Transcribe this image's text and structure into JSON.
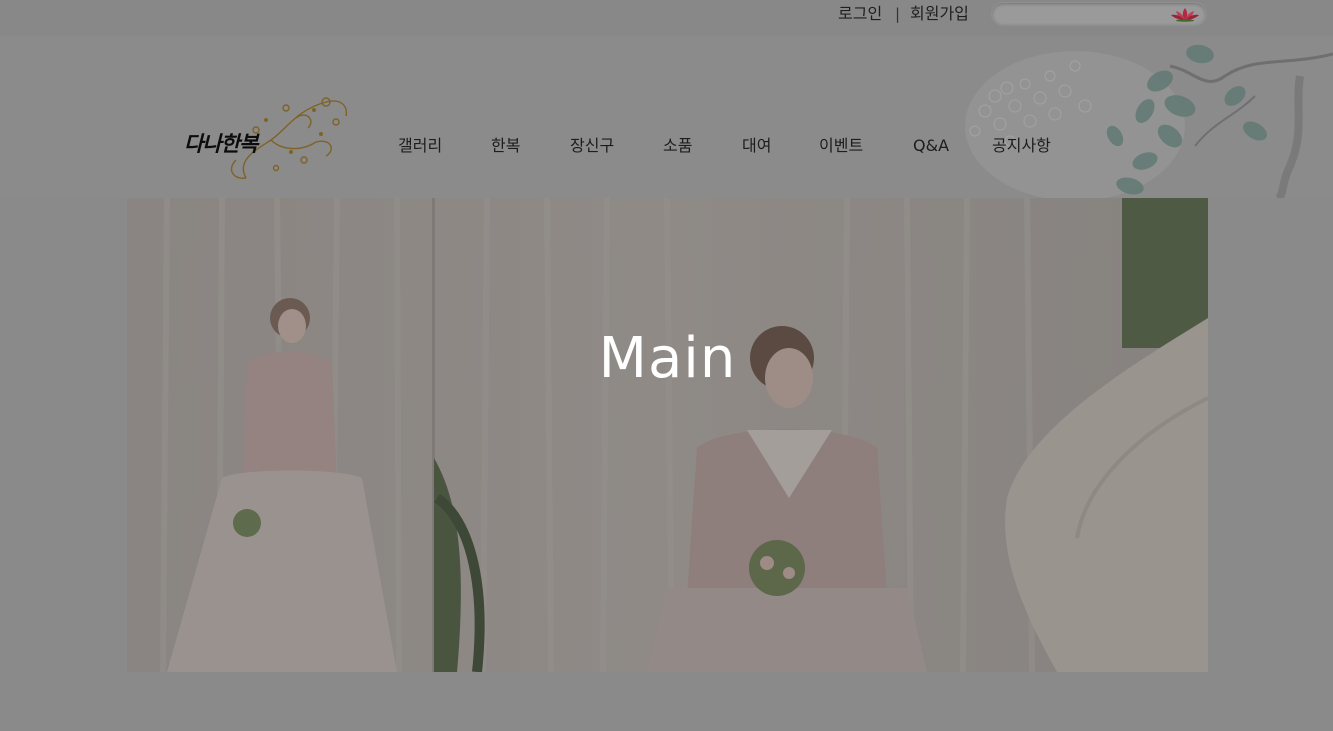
{
  "top_bar": {
    "login_label": "로그인",
    "separator": "|",
    "signup_label": "회원가입",
    "search": {
      "placeholder": "",
      "value": ""
    }
  },
  "header": {
    "logo_text": "다나한복",
    "nav": [
      {
        "label": "갤러리"
      },
      {
        "label": "한복"
      },
      {
        "label": "장신구"
      },
      {
        "label": "소품"
      },
      {
        "label": "대여"
      },
      {
        "label": "이벤트"
      },
      {
        "label": "Q&A"
      },
      {
        "label": "공지사항"
      }
    ]
  },
  "hero": {
    "title": "Main"
  },
  "icons": {
    "search_button": "lotus-icon",
    "header_decoration": "floral-branch-icon"
  },
  "colors": {
    "overlay_gray": "#8a8a8a",
    "logo_gold": "#8a6a2a",
    "lotus_red": "#b8324a"
  }
}
